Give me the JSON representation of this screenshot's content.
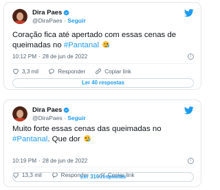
{
  "tweets": [
    {
      "author_name": "Dira Paes",
      "author_handle": "@DiraPaes",
      "separator": "·",
      "follow_label": "Seguir",
      "text_before": "Coração fica até apertado com essas cenas de queimadas no ",
      "hashtag": "#Pantanal",
      "text_after": "",
      "time": "10:12 PM",
      "date_sep": "·",
      "date": "28 de jun de 2022",
      "likes": "3,3 mil",
      "reply_label": "Responder",
      "copy_label": "Copiar link",
      "read_replies_label": "Ler 40 respostas"
    },
    {
      "author_name": "Dira Paes",
      "author_handle": "@DiraPaes",
      "separator": "·",
      "follow_label": "Seguir",
      "text_before": "Muito forte essas cenas das queimadas no ",
      "hashtag": "#Pantanal",
      "text_after": ". Que dor",
      "time": "10:19 PM",
      "date_sep": "·",
      "date": "28 de jun de 2022",
      "likes": "13,3 mil",
      "reply_label": "Responder",
      "copy_label": "Copiar link",
      "read_replies_label": "Ler 316 respostas"
    }
  ],
  "colors": {
    "accent": "#1d9bf0",
    "like": "#536471",
    "text": "#0f1419",
    "secondary": "#536471",
    "border": "#e3e7eb"
  },
  "icons": [
    "verified-badge-icon",
    "twitter-bird-icon",
    "heart-icon",
    "reply-bubble-icon",
    "link-icon",
    "info-icon",
    "crying-face-emoji"
  ]
}
